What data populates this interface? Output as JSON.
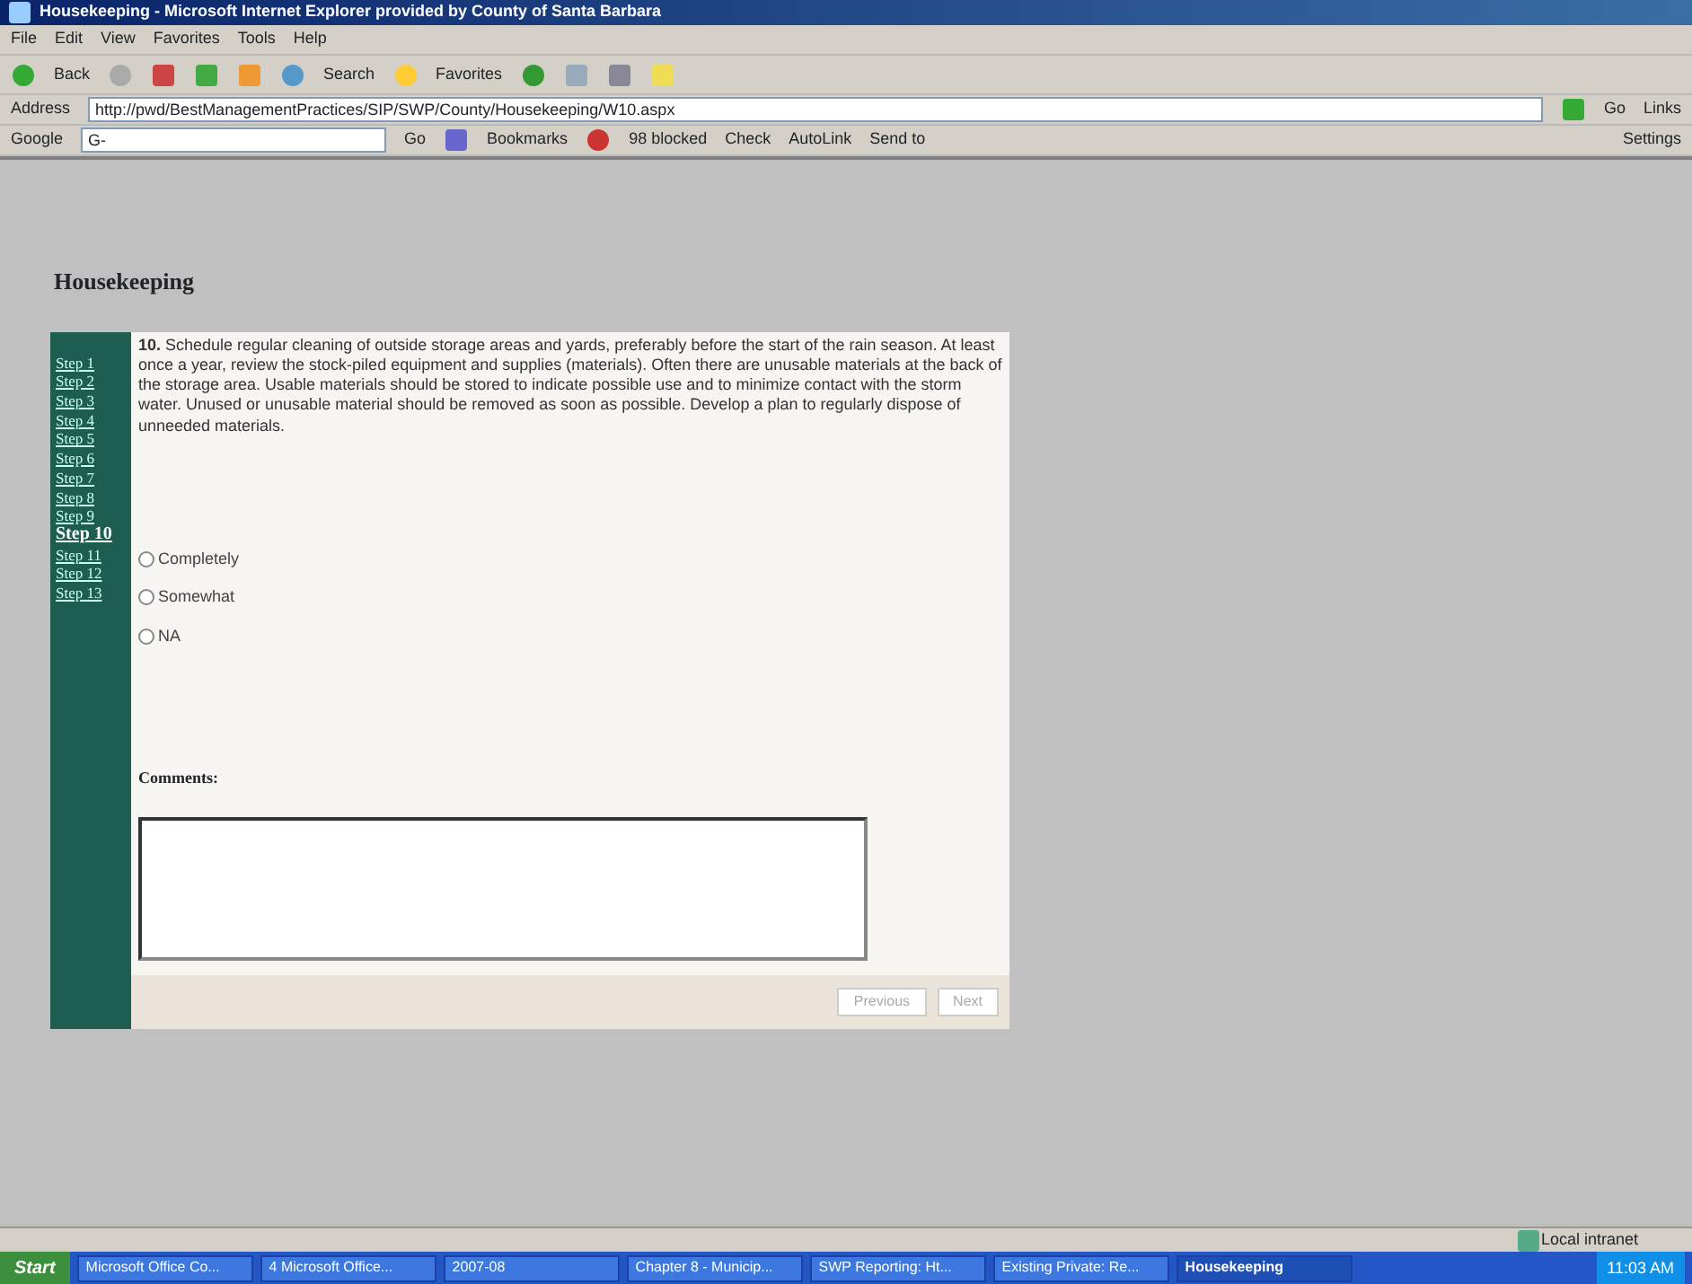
{
  "window": {
    "title": "Housekeeping - Microsoft Internet Explorer provided by County of Santa Barbara"
  },
  "menu": [
    "File",
    "Edit",
    "View",
    "Favorites",
    "Tools",
    "Help"
  ],
  "toolbar": {
    "back": "Back",
    "search": "Search",
    "favorites": "Favorites"
  },
  "address": {
    "label": "Address",
    "value": "http://pwd/BestManagementPractices/SIP/SWP/County/Housekeeping/W10.aspx",
    "go": "Go",
    "links": "Links"
  },
  "google_bar": {
    "label": "Google",
    "search": "G-",
    "go": "Go",
    "bookmarks": "Bookmarks",
    "blocked": "98 blocked",
    "check": "Check",
    "autolink": "AutoLink",
    "send": "Send to",
    "settings": "Settings"
  },
  "page": {
    "heading": "Housekeeping",
    "steps": [
      {
        "label": "Step 1",
        "selected": false
      },
      {
        "label": "Step 2",
        "selected": false
      },
      {
        "label": "Step 3",
        "selected": false
      },
      {
        "label": "Step 4",
        "selected": false
      },
      {
        "label": "Step 5",
        "selected": false
      },
      {
        "label": "Step 6",
        "selected": false
      },
      {
        "label": "Step 7",
        "selected": false
      },
      {
        "label": "Step 8",
        "selected": false
      },
      {
        "label": "Step 9",
        "selected": false
      },
      {
        "label": "Step 10",
        "selected": true
      },
      {
        "label": "Step 11",
        "selected": false
      },
      {
        "label": "Step 12",
        "selected": false
      },
      {
        "label": "Step 13",
        "selected": false
      }
    ],
    "question": "**10.** Schedule regular cleaning of outside storage areas and yards, preferably before the start of the rain season. At least once a year, review the stock-piled equipment and supplies (materials). Often there are unusable materials at the back of the storage area. Usable materials should be stored to indicate possible use and to minimize contact with the storm water. Unused or unusable material should be removed as soon as possible. Develop a plan to regularly dispose of unneeded materials.",
    "options": [
      {
        "label": "Completely",
        "selected": false
      },
      {
        "label": "Somewhat",
        "selected": false
      },
      {
        "label": "NA",
        "selected": false
      }
    ],
    "comments_label": "Comments:",
    "buttons": [
      {
        "label": "Previous",
        "disabled": true
      },
      {
        "label": "Next",
        "disabled": true
      }
    ]
  },
  "status_bar": {
    "zone": "Local intranet"
  },
  "taskbar": {
    "start": "Start",
    "items": [
      {
        "label": "Microsoft Office Co...",
        "selected": false
      },
      {
        "label": "4 Microsoft Office...",
        "selected": false
      },
      {
        "label": "2007-08",
        "selected": false
      },
      {
        "label": "Chapter 8 - Municip...",
        "selected": false
      },
      {
        "label": "SWP Reporting: Ht...",
        "selected": false
      },
      {
        "label": "Existing Private: Re...",
        "selected": false
      },
      {
        "label": "Housekeeping",
        "selected": true
      }
    ],
    "clock": "11:03 AM"
  }
}
